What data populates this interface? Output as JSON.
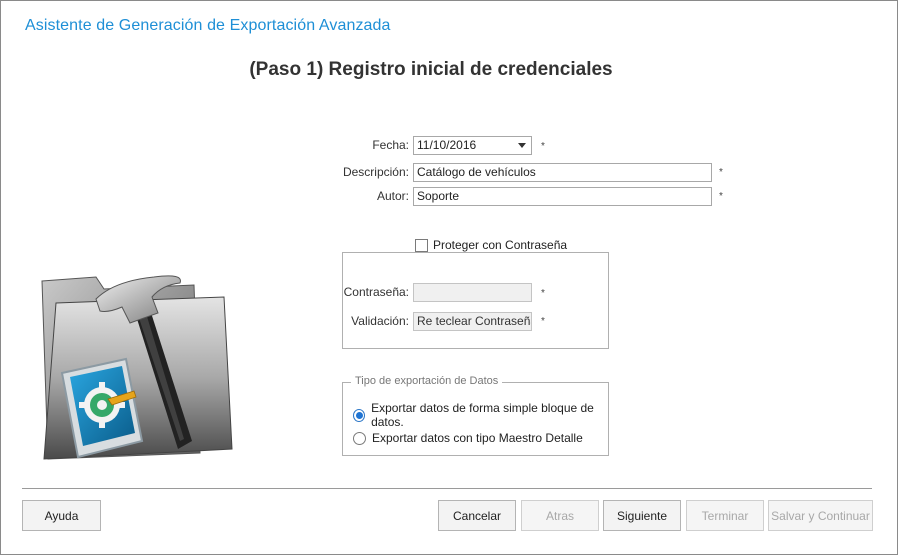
{
  "window": {
    "title": "Asistente de Generación de Exportación Avanzada",
    "step_title": "(Paso 1) Registro inicial de credenciales"
  },
  "form": {
    "fecha": {
      "label": "Fecha:",
      "value": "11/10/2016"
    },
    "descripcion": {
      "label": "Descripción:",
      "value": "Catálogo de vehículos"
    },
    "autor": {
      "label": "Autor:",
      "value": "Soporte"
    },
    "required_mark": "*"
  },
  "password": {
    "protect_label": "Proteger con Contraseña",
    "protect_checked": false,
    "contrasena": {
      "label": "Contraseña:",
      "value": ""
    },
    "validacion": {
      "label": "Validación:",
      "value": "Re teclear Contraseña"
    }
  },
  "export_type": {
    "legend": "Tipo de exportación de Datos",
    "options": [
      {
        "label": "Exportar datos de forma simple bloque de datos.",
        "selected": true
      },
      {
        "label": "Exportar datos con tipo Maestro Detalle",
        "selected": false
      }
    ]
  },
  "buttons": {
    "help": "Ayuda",
    "cancel": "Cancelar",
    "back": "Atras",
    "next": "Siguiente",
    "finish": "Terminar",
    "save_continue": "Salvar y Continuar"
  },
  "colors": {
    "title_blue": "#1e8fd6",
    "radio_accent": "#1f74d3"
  },
  "icons": {
    "illustration": "folder-hammer-settings-icon",
    "date_dropdown": "chevron-down-icon"
  }
}
